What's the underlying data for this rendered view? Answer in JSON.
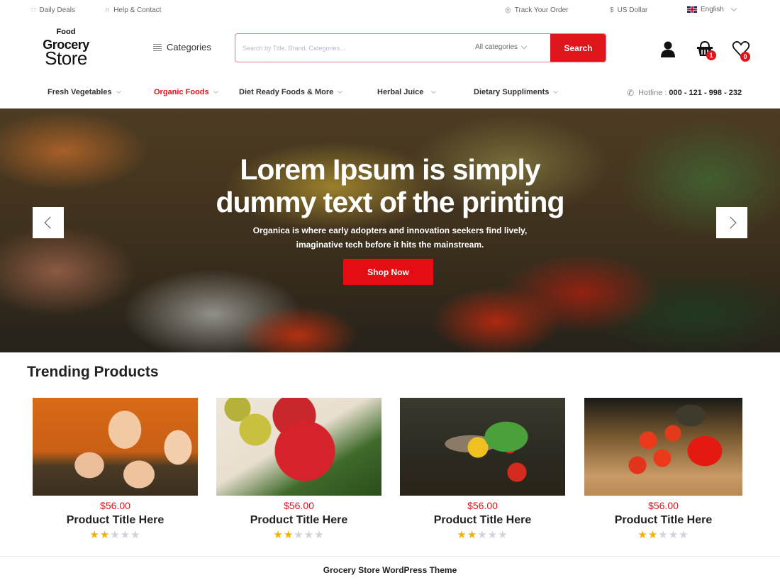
{
  "topbar": {
    "daily_deals": "Daily Deals",
    "help_contact": "Help & Contact",
    "track_order": "Track Your Order",
    "currency": "US Dollar",
    "language": "English"
  },
  "logo": {
    "line1": "Food",
    "line2": "Grocery",
    "line3": "Store"
  },
  "header": {
    "categories_label": "Categories",
    "search_placeholder": "Search by Title, Brand, Categories...",
    "category_select": "All categories",
    "search_button": "Search",
    "cart_count": "1",
    "wishlist_count": "0"
  },
  "nav": {
    "items": [
      {
        "label": "Fresh Vegetables",
        "active": false
      },
      {
        "label": "Organic Foods",
        "active": true
      },
      {
        "label": "Diet Ready Foods & More",
        "active": false
      },
      {
        "label": "Herbal Juice",
        "active": false
      },
      {
        "label": "Dietary Suppliments",
        "active": false
      }
    ],
    "hotline_label": "Hotline :",
    "hotline_number": "000 - 121 - 998 - 232"
  },
  "hero": {
    "title_line1": "Lorem Ipsum is simply",
    "title_line2": "dummy text of the printing",
    "subtitle_line1": "Organica is where early adopters and innovation seekers find lively,",
    "subtitle_line2": "imaginative tech before it hits the mainstream.",
    "cta": "Shop Now"
  },
  "trending": {
    "title": "Trending Products",
    "products": [
      {
        "image": "eggs-in-nest",
        "price": "$56.00",
        "title": "Product Title Here",
        "rating": 2,
        "max_rating": 5
      },
      {
        "image": "apples-in-crate",
        "price": "$56.00",
        "title": "Product Title Here",
        "rating": 2,
        "max_rating": 5
      },
      {
        "image": "vegetable-basket",
        "price": "$56.00",
        "title": "Product Title Here",
        "rating": 2,
        "max_rating": 5
      },
      {
        "image": "tomatoes-peppers-basket",
        "price": "$56.00",
        "title": "Product Title Here",
        "rating": 2,
        "max_rating": 5
      }
    ]
  },
  "footer": {
    "text": "Grocery Store WordPress Theme"
  },
  "colors": {
    "accent": "#e0141b",
    "star": "#f5b000",
    "star_empty": "#d2d2de"
  }
}
